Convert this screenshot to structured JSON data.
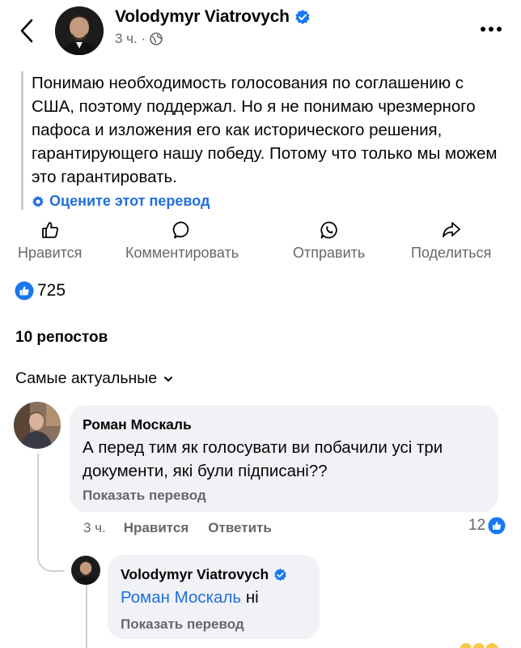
{
  "post": {
    "author": "Volodymyr Viatrovych",
    "time": "3 ч. ·",
    "text": "Понимаю необходимость голосования по соглашению с США, поэтому поддержал. Но я не понимаю чрезмерного пафоса и изложения его как исторического решения, гарантирующего нашу победу. Потому что только мы можем это гарантировать.",
    "rate_translation": "Оцените этот перевод"
  },
  "actions": {
    "like": "Нравится",
    "comment": "Комментировать",
    "send": "Отправить",
    "share": "Поделиться"
  },
  "stats": {
    "reactions": "725",
    "reposts": "10 репостов"
  },
  "sort": {
    "label": "Самые актуальные"
  },
  "comments": [
    {
      "author": "Роман Москаль",
      "text": "А перед тим як голосувати ви побачили усі три документи, які були підписані??",
      "show_translation": "Показать перевод",
      "time": "3 ч.",
      "like_label": "Нравится",
      "reply_label": "Ответить",
      "likes": "12"
    }
  ],
  "reply": {
    "author": "Volodymyr Viatrovych",
    "mention": "Роман Москаль",
    "text": "ні",
    "show_translation": "Показать перевод"
  },
  "colors": {
    "accent": "#216fdb",
    "like_blue": "#1877f2",
    "verified": "#1877f2",
    "muted": "#65676b",
    "bubble": "#f0f2f5",
    "emoji_yellow": "#f7c948"
  },
  "icons": {
    "back": "chevron-left-icon",
    "verified": "verified-badge-icon",
    "globe": "globe-icon",
    "more": "more-dots-icon",
    "gear": "gear-icon",
    "like": "thumbs-up-icon",
    "comment": "comment-bubble-icon",
    "send": "whatsapp-icon",
    "share": "share-arrow-icon",
    "sort": "chevron-down-icon"
  }
}
